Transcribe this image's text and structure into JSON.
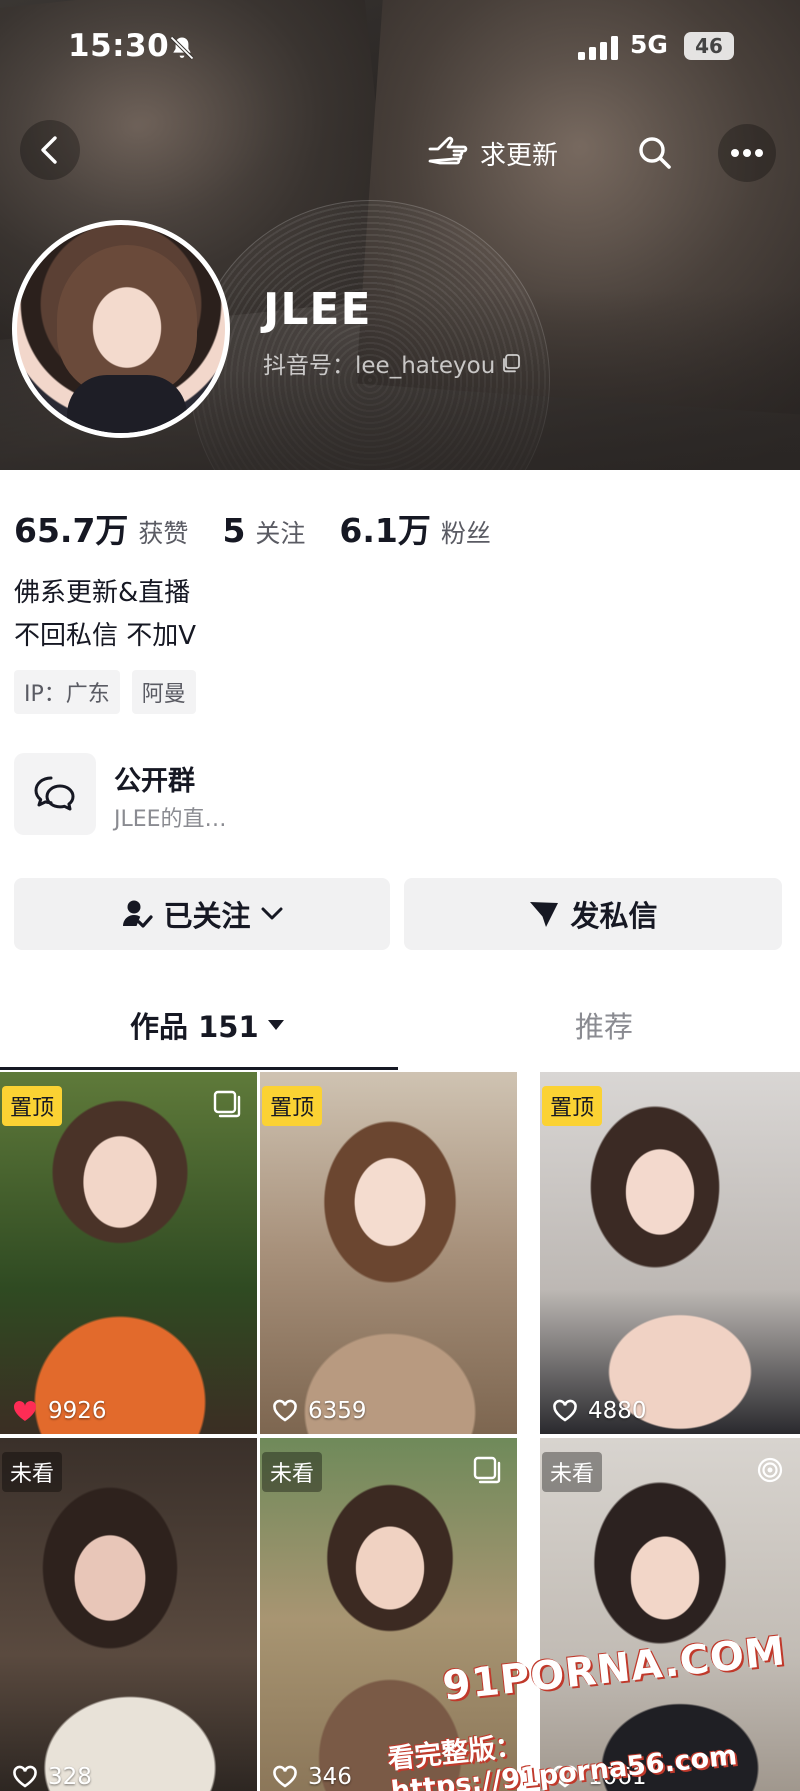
{
  "status_bar": {
    "time": "15:30",
    "network": "5G",
    "battery": "46"
  },
  "nav": {
    "request_update_label": "求更新"
  },
  "profile": {
    "name": "JLEE",
    "douyin_id": "抖音号：lee_hateyou",
    "stats": [
      {
        "num": "65.7万",
        "label": "获赞"
      },
      {
        "num": "5",
        "label": "关注"
      },
      {
        "num": "6.1万",
        "label": "粉丝"
      }
    ],
    "bio_lines": [
      "佛系更新&直播",
      "不回私信 不加V"
    ],
    "tags": [
      "IP：广东",
      "阿曼"
    ]
  },
  "group": {
    "title": "公开群",
    "subtitle": "JLEE的直…"
  },
  "actions": {
    "follow_label": "已关注",
    "message_label": "发私信"
  },
  "tabs": {
    "works_label": "作品 151",
    "recommend_label": "推荐"
  },
  "videos": [
    {
      "badge": "置顶",
      "likes": "9926",
      "liked": true
    },
    {
      "badge": "置顶",
      "likes": "6359",
      "liked": false
    },
    {
      "badge": "置顶",
      "likes": "4880",
      "liked": false
    },
    {
      "badge": "未看",
      "likes": "328",
      "liked": false
    },
    {
      "badge": "未看",
      "likes": "346",
      "liked": false
    },
    {
      "badge": "未看",
      "likes": "1061",
      "liked": false
    }
  ],
  "watermark": {
    "brand": "91PORNA.COM",
    "link": "看完整版：https://91porna56.com"
  },
  "colors": {
    "pinned_badge": "#fbd233",
    "liked_heart": "#fe2c55",
    "text_primary": "#161823",
    "text_secondary": "#8a8b91"
  }
}
